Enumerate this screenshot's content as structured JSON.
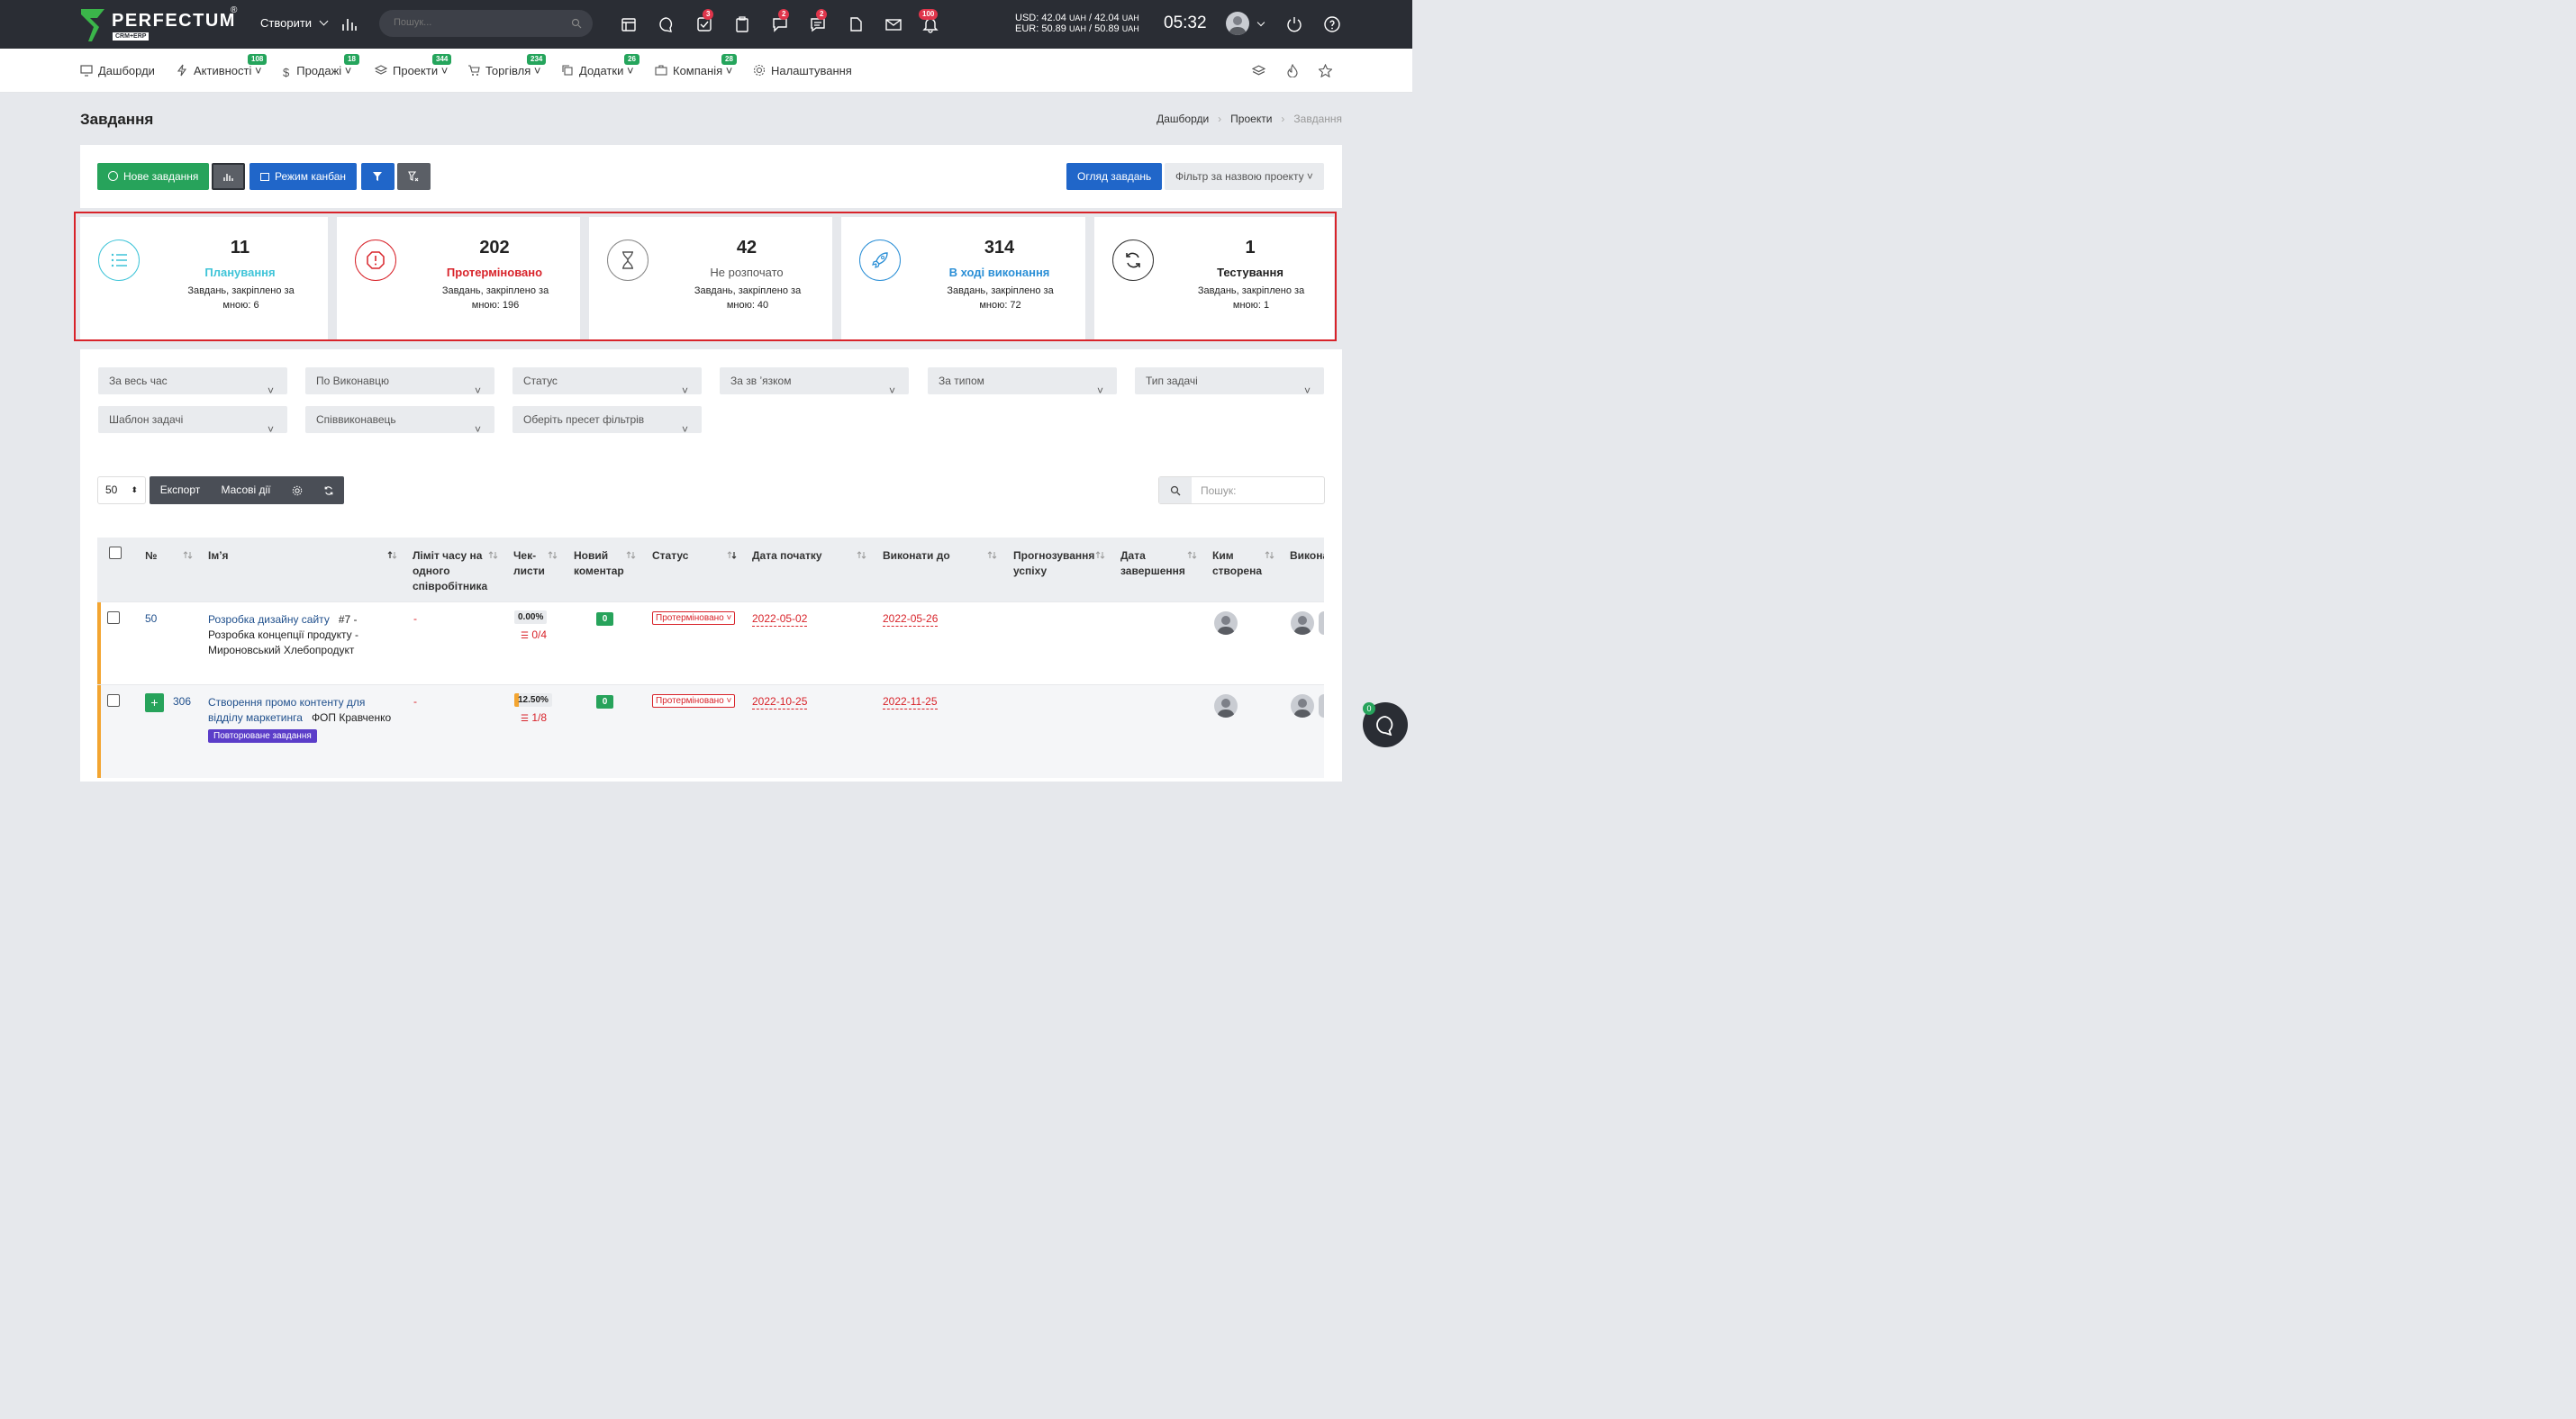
{
  "topbar": {
    "logo_text": "PERFECTUM",
    "logo_sub": "CRM+ERP",
    "logo_reg": "®",
    "create_label": "Створити",
    "search_placeholder": "Пошук...",
    "badges": {
      "tasks": "3",
      "chat": "2",
      "comments": "2",
      "notifications": "100"
    },
    "usd_label": "USD: 42.04",
    "usd_rest": "/ 42.04",
    "eur_label": "EUR: 50.89",
    "eur_rest": "/ 50.89",
    "uah": "UAH",
    "time": "05:32"
  },
  "nav": {
    "items": [
      {
        "label": "Дашборди",
        "icon": "monitor-icon"
      },
      {
        "label": "Активності",
        "icon": "lightning-icon",
        "badge": "108"
      },
      {
        "label": "Продажі",
        "icon": "dollar-icon",
        "badge": "18"
      },
      {
        "label": "Проекти",
        "icon": "layers-icon",
        "badge": "344"
      },
      {
        "label": "Торгівля",
        "icon": "cart-icon",
        "badge": "234"
      },
      {
        "label": "Додатки",
        "icon": "copy-icon",
        "badge": "26"
      },
      {
        "label": "Компанія",
        "icon": "briefcase-icon",
        "badge": "28"
      },
      {
        "label": "Налаштування",
        "icon": "gear-icon"
      }
    ]
  },
  "page": {
    "title": "Завдання",
    "breadcrumbs": [
      "Дашборди",
      "Проекти",
      "Завдання"
    ]
  },
  "toolbar": {
    "new_task": "Нове завдання",
    "kanban": "Режим канбан",
    "overview": "Огляд завдань",
    "project_filter": "Фільтр за назвою проекту"
  },
  "stats": [
    {
      "num": "11",
      "label": "Планування",
      "sub": "Завдань, закріплено за мною: 6",
      "color": "#3fc4d8",
      "icon": "list-icon"
    },
    {
      "num": "202",
      "label": "Протерміновано",
      "sub": "Завдань, закріплено за мною: 196",
      "color": "#d8232a",
      "icon": "alert-icon"
    },
    {
      "num": "42",
      "label": "Не розпочато",
      "sub": "Завдань, закріплено за мною: 40",
      "color": "#555555",
      "icon": "hourglass-icon"
    },
    {
      "num": "314",
      "label": "В ході виконання",
      "sub": "Завдань, закріплено за мною: 72",
      "color": "#2b8fd6",
      "icon": "rocket-icon"
    },
    {
      "num": "1",
      "label": "Тестування",
      "sub": "Завдань, закріплено за мною: 1",
      "color": "#222222",
      "icon": "refresh-icon"
    }
  ],
  "filters": [
    "За весь час",
    "По Виконавцю",
    "Статус",
    "За зв ʼязком",
    "За типом",
    "Тип задачі",
    "Шаблон задачі",
    "Співвиконавець",
    "Оберіть пресет фільтрів"
  ],
  "table_toolbar": {
    "per_page": "50",
    "export": "Експорт",
    "mass": "Масові дії",
    "search_placeholder": "Пошук:"
  },
  "table": {
    "headers": [
      "№",
      "Імʼя",
      "Ліміт часу на одного співробітника",
      "Чек-листи",
      "Новий коментар",
      "Статус",
      "Дата початку",
      "Виконати до",
      "Прогнозування успіху",
      "Дата завершення",
      "Ким створена",
      "Викона"
    ],
    "rows": [
      {
        "num": "50",
        "name": "Розробка дизайну сайту",
        "extra": "#7 - Розробка концепції продукту - Мироновський Хлебопродукт",
        "limit": "-",
        "pct": "0.00%",
        "checklist": "0/4",
        "comments": "0",
        "status": "Протерміновано",
        "start": "2022-05-02",
        "due": "2022-05-26"
      },
      {
        "num": "306",
        "name": "Створення промо контенту для відділу маркетинга",
        "extra": "ФОП Кравченко",
        "tag": "Повторюване завдання",
        "limit": "-",
        "pct": "12.50%",
        "pct_value": 0.125,
        "checklist": "1/8",
        "comments": "0",
        "status": "Протерміновано",
        "start": "2022-10-25",
        "due": "2022-11-25"
      }
    ]
  },
  "chat": {
    "badge": "0"
  }
}
